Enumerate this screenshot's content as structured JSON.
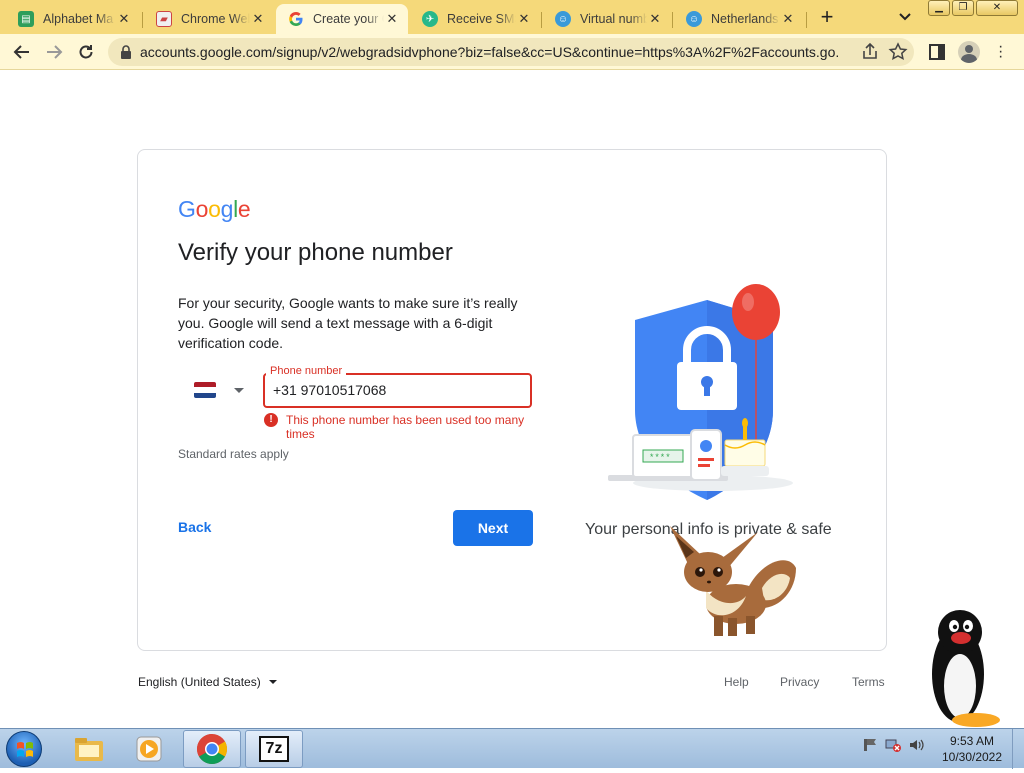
{
  "browser": {
    "tabs": [
      {
        "title": "Alphabet Ma",
        "favicon": "sheet-favicon-icon",
        "active": false
      },
      {
        "title": "Chrome Web",
        "favicon": "chrome-webstore-favicon-icon",
        "active": false
      },
      {
        "title": "Create your G",
        "favicon": "google-favicon-icon",
        "active": true
      },
      {
        "title": "Receive SMS",
        "favicon": "sms-favicon-icon",
        "active": false
      },
      {
        "title": "Virtual numb",
        "favicon": "chat-favicon-icon",
        "active": false
      },
      {
        "title": "Netherlands",
        "favicon": "chat-favicon-icon",
        "active": false
      }
    ],
    "url": "accounts.google.com/signup/v2/webgradsidvphone?biz=false&cc=US&continue=https%3A%2F%2Faccounts.go..."
  },
  "page": {
    "logo": [
      "G",
      "o",
      "o",
      "g",
      "l",
      "e"
    ],
    "logo_colors": [
      "#4285f4",
      "#ea4335",
      "#fbbc05",
      "#4285f4",
      "#34a853",
      "#ea4335"
    ],
    "heading": "Verify your phone number",
    "description": "For your security, Google wants to make sure it’s really you. Google will send a text message with a 6-digit verification code.",
    "country_flag": "netherlands-flag",
    "phone_label": "Phone number",
    "phone_value": "+31 97010517068",
    "error": "This phone number has been used too many times",
    "rates_note": "Standard rates apply",
    "back_label": "Back",
    "next_label": "Next",
    "illustration_caption": "Your personal info is private & safe",
    "illustration_password": "****"
  },
  "footer": {
    "language": "English (United States)",
    "links": [
      "Help",
      "Privacy",
      "Terms"
    ]
  },
  "taskbar": {
    "time": "9:53 AM",
    "date": "10/30/2022",
    "apps": [
      "file-explorer-icon",
      "media-player-icon",
      "chrome-icon",
      "7zip-icon"
    ],
    "active_app": "7zip-icon",
    "sevenzip_label": "7z"
  },
  "colors": {
    "accent": "#1a73e8",
    "error": "#d93025",
    "tabstrip": "#f5d97a",
    "toolbar": "#fff8d6"
  }
}
